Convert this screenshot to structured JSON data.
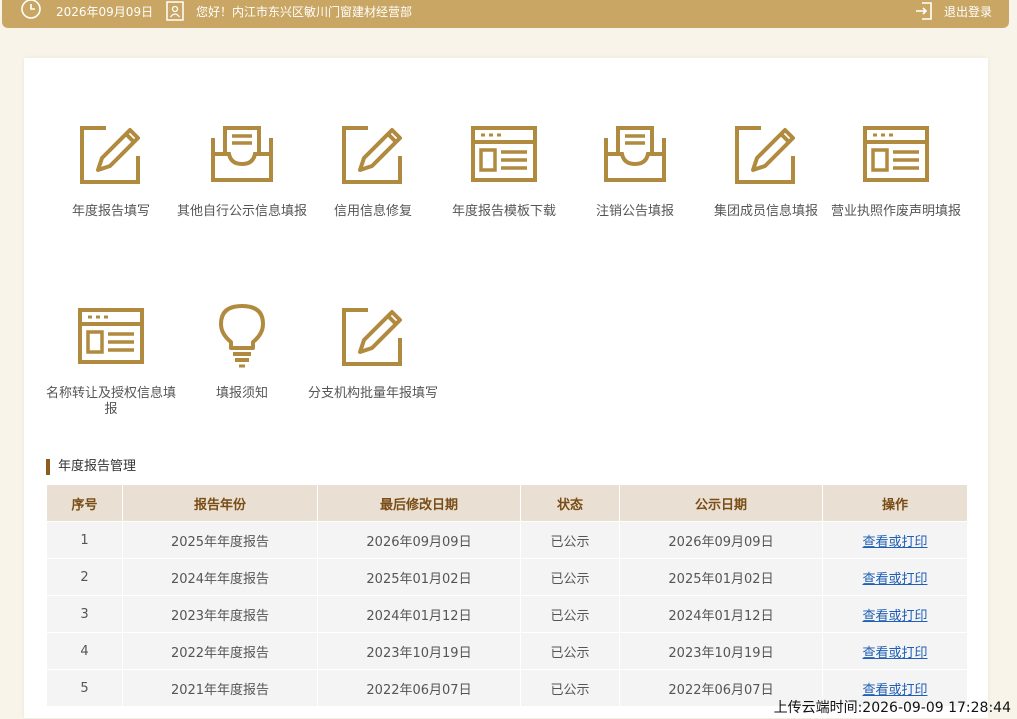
{
  "topbar": {
    "date": "2026年09月09日",
    "greeting": "您好！内江市东兴区敏川门窗建材经营部",
    "logout": "退出登录"
  },
  "tiles": [
    {
      "label": "年度报告填写",
      "icon": "edit-icon"
    },
    {
      "label": "其他自行公示信息填报",
      "icon": "tray-icon"
    },
    {
      "label": "信用信息修复",
      "icon": "edit-icon"
    },
    {
      "label": "年度报告模板下载",
      "icon": "form-window-icon"
    },
    {
      "label": "注销公告填报",
      "icon": "tray-icon"
    },
    {
      "label": "集团成员信息填报",
      "icon": "edit-icon"
    },
    {
      "label": "营业执照作废声明填报",
      "icon": "form-window-icon"
    },
    {
      "label": "名称转让及授权信息填报",
      "icon": "form-window-icon"
    },
    {
      "label": "填报须知",
      "icon": "lightbulb-icon"
    },
    {
      "label": "分支机构批量年报填写",
      "icon": "edit-icon"
    }
  ],
  "section": {
    "title": "年度报告管理"
  },
  "table": {
    "headers": [
      "序号",
      "报告年份",
      "最后修改日期",
      "状态",
      "公示日期",
      "操作"
    ],
    "rows": [
      [
        "1",
        "2025年年度报告",
        "2026年09月09日",
        "已公示",
        "2026年09月09日",
        "查看或打印"
      ],
      [
        "2",
        "2024年年度报告",
        "2025年01月02日",
        "已公示",
        "2025年01月02日",
        "查看或打印"
      ],
      [
        "3",
        "2023年年度报告",
        "2024年01月12日",
        "已公示",
        "2024年01月12日",
        "查看或打印"
      ],
      [
        "4",
        "2022年年度报告",
        "2023年10月19日",
        "已公示",
        "2023年10月19日",
        "查看或打印"
      ],
      [
        "5",
        "2021年年度报告",
        "2022年06月07日",
        "已公示",
        "2022年06月07日",
        "查看或打印"
      ]
    ]
  },
  "upload_time": "上传云端时间:2026-09-09 17:28:44",
  "colors": {
    "accent": "#c9a663",
    "icon": "#b08a3e",
    "header_text": "#7a4c16",
    "link": "#1f5fb5"
  }
}
